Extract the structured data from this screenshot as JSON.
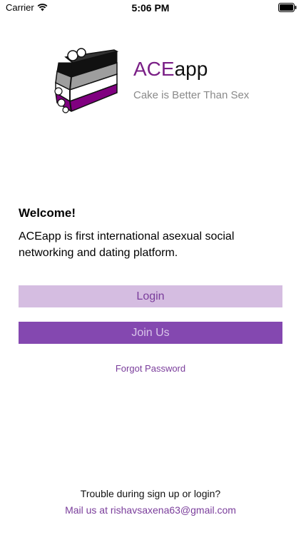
{
  "status_bar": {
    "carrier": "Carrier",
    "time": "5:06 PM"
  },
  "logo": {
    "brand_part1": "ACE",
    "brand_part2": "app",
    "tagline": "Cake is Better Than Sex",
    "colors": {
      "black": "#111111",
      "gray": "#9e9e9e",
      "white": "#ffffff",
      "purple": "#800080"
    }
  },
  "welcome": {
    "title": "Welcome!",
    "description": "ACEapp is first international asexual social networking and dating platform."
  },
  "buttons": {
    "login": "Login",
    "join": "Join Us"
  },
  "links": {
    "forgot_password": "Forgot Password"
  },
  "footer": {
    "trouble_text": "Trouble during sign up or login?",
    "mail_text": "Mail us at rishavsaxena63@gmail.com"
  },
  "theme": {
    "accent": "#8448b0",
    "accent_light": "#d5bde1",
    "link": "#7a3d9b"
  }
}
